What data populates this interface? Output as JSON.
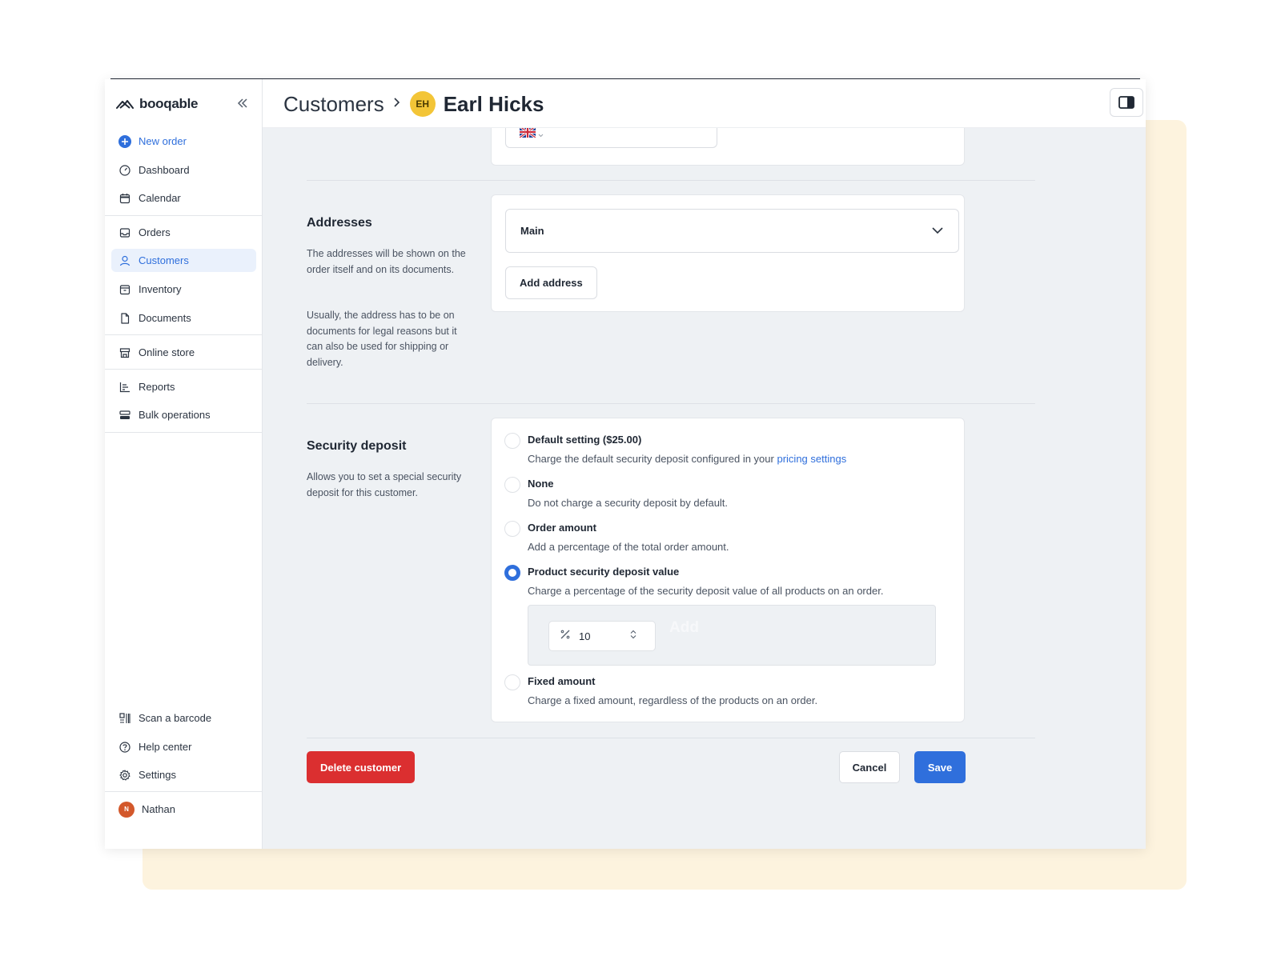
{
  "brand": {
    "name": "booqable"
  },
  "sidebar": {
    "new_order": "New order",
    "items": [
      {
        "label": "Dashboard"
      },
      {
        "label": "Calendar"
      },
      {
        "label": "Orders"
      },
      {
        "label": "Customers"
      },
      {
        "label": "Inventory"
      },
      {
        "label": "Documents"
      },
      {
        "label": "Online store"
      },
      {
        "label": "Reports"
      },
      {
        "label": "Bulk operations"
      }
    ],
    "bottom": [
      {
        "label": "Scan a barcode"
      },
      {
        "label": "Help center"
      },
      {
        "label": "Settings"
      }
    ],
    "user": {
      "name": "Nathan",
      "initial": "N"
    },
    "active_item": "Customers"
  },
  "header": {
    "breadcrumb_parent": "Customers",
    "customer_initials": "EH",
    "customer_name": "Earl Hicks"
  },
  "addresses": {
    "title": "Addresses",
    "desc1": "The addresses will be shown on the order itself and on its documents.",
    "desc2": "Usually, the address has to be on documents for legal reasons but it can also be used for shipping or delivery.",
    "selected": "Main",
    "add_button": "Add address"
  },
  "deposit": {
    "title": "Security deposit",
    "desc": "Allows you to set a special security deposit for this customer.",
    "options": [
      {
        "label": "Default setting ($25.00)",
        "desc": "Charge the default security deposit configured in your",
        "link": "pricing settings",
        "checked": false
      },
      {
        "label": "None",
        "desc": "Do not charge a security deposit by default.",
        "checked": false
      },
      {
        "label": "Order amount",
        "desc": "Add a percentage of the total order amount.",
        "checked": false
      },
      {
        "label": "Product security deposit value",
        "desc": "Charge a percentage of the security deposit value of all products on an order.",
        "checked": true
      },
      {
        "label": "Fixed amount",
        "desc": "Charge a fixed amount, regardless of the products on an order.",
        "checked": false
      }
    ],
    "percentage_value": "10",
    "ghost_add": "Add"
  },
  "actions": {
    "delete": "Delete customer",
    "cancel": "Cancel",
    "save": "Save"
  },
  "colors": {
    "accent": "#2f6fdc",
    "danger": "#db2f30",
    "avatar_customer": "#f3c537",
    "avatar_user": "#d3582b",
    "backdrop": "#fdf3de"
  }
}
